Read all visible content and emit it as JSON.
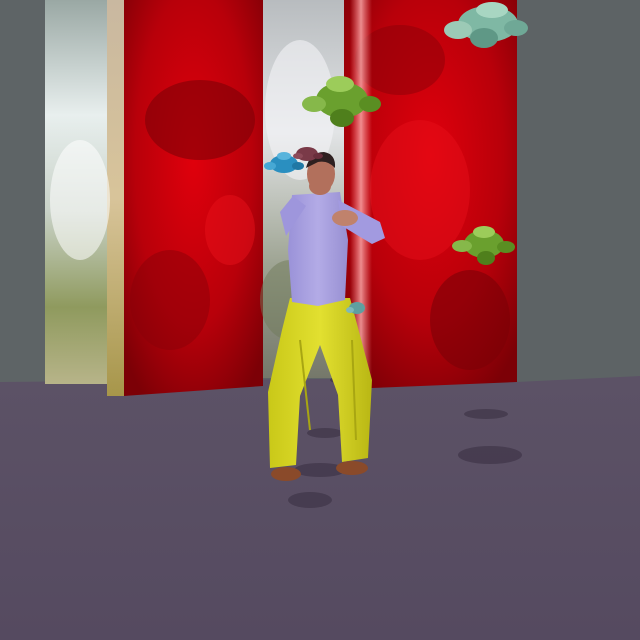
{
  "scene": {
    "description_free": true,
    "colors": {
      "background_wall": "#5e6466",
      "floor": "#5a4f65",
      "red_wall": "#c40008",
      "red_dark": "#7d0006",
      "mirror_light": "#dfe6e4",
      "shirt": "#a79fe0",
      "pants": "#d8d81e",
      "skin": "#b2705c",
      "hair": "#2e2020",
      "shoes": "#8a4a2a",
      "gem_green": "#6aa02e",
      "gem_teal": "#7fb8a4",
      "gem_blue": "#2a8fc0",
      "gem_maroon": "#7a3a48"
    },
    "objects": [
      {
        "name": "left-mirror-block-icon"
      },
      {
        "name": "red-wall-panel-icon"
      },
      {
        "name": "dancing-figure-icon"
      },
      {
        "name": "floating-gem-cluster-icon"
      }
    ]
  }
}
